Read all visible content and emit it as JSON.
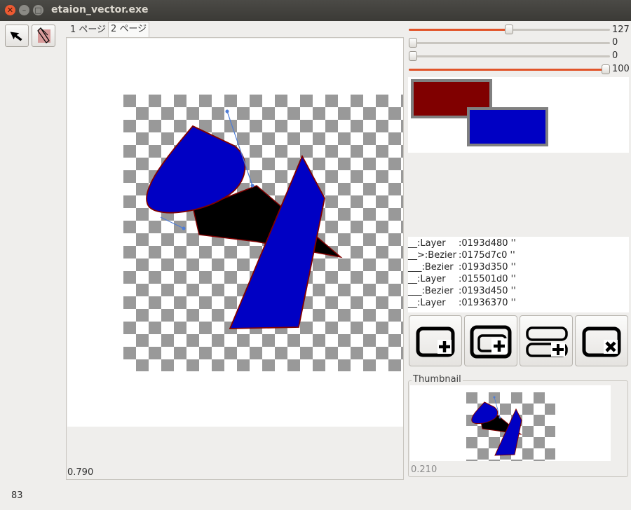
{
  "window": {
    "title": "etaion_vector.exe"
  },
  "tools": {
    "arrow": "arrow-tool",
    "bezier": "bezier-tool"
  },
  "tabs": [
    {
      "label": "1 ページ",
      "active": false
    },
    {
      "label": "2 ページ",
      "active": true
    }
  ],
  "canvas": {
    "zoom": "0.790"
  },
  "status": {
    "value": "83"
  },
  "sliders": [
    {
      "value": "127",
      "fraction": 0.498
    },
    {
      "value": "0",
      "fraction": 0
    },
    {
      "value": "0",
      "fraction": 0
    },
    {
      "value": "100",
      "fraction": 1.0
    }
  ],
  "colors": {
    "stroke": "#800000",
    "fill": "#0000c4",
    "accent": "#e1542a",
    "swatch_border": "#808080"
  },
  "layers": [
    {
      "name": "__:Layer",
      "addr": ":0193d480 ''"
    },
    {
      "name": "__>:Bezier",
      "addr": ":0175d7c0 ''"
    },
    {
      "name": "___:Bezier",
      "addr": ":0193d350 ''"
    },
    {
      "name": "__:Layer",
      "addr": ":015501d0 ''"
    },
    {
      "name": "___:Bezier",
      "addr": ":0193d450 ''"
    },
    {
      "name": "__:Layer",
      "addr": ":01936370 ''"
    }
  ],
  "layer_buttons": [
    "add-layer-icon",
    "add-child-layer-icon",
    "add-sibling-layer-icon",
    "delete-layer-icon"
  ],
  "thumbnail": {
    "label": "Thumbnail",
    "zoom": "0.210"
  }
}
